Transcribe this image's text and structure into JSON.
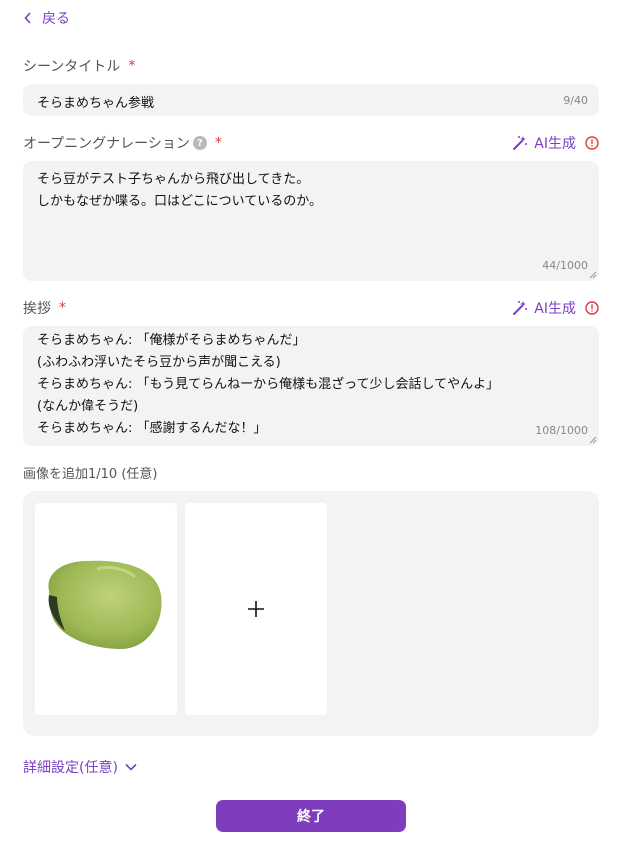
{
  "header": {
    "back_label": "戻る"
  },
  "scene_title": {
    "label": "シーンタイトル",
    "required_mark": "*",
    "value": "そらまめちゃん参戦",
    "counter": "9/40"
  },
  "opening_narration": {
    "label": "オープニングナレーション",
    "help_mark": "?",
    "required_mark": "*",
    "ai_label": "AI生成",
    "text": "そら豆がテスト子ちゃんから飛び出してきた。\nしかもなぜか喋る。口はどこについているのか。",
    "counter": "44/1000"
  },
  "greeting": {
    "label": "挨拶",
    "required_mark": "*",
    "ai_label": "AI生成",
    "text": "そらまめちゃん: 「俺様がそらまめちゃんだ」\n(ふわふわ浮いたそら豆から声が聞こえる)\nそらまめちゃん: 「もう見てらんねーから俺様も混ざって少し会話してやんよ」\n(なんか偉そうだ)\nそらまめちゃん: 「感謝するんだな！」",
    "counter": "108/1000"
  },
  "images": {
    "label": "画像を追加1/10 (任意)",
    "add_symbol": "+"
  },
  "details": {
    "label": "詳細設定(任意)"
  },
  "finish_button": {
    "label": "終了"
  },
  "colors": {
    "accent": "#7f3dbd",
    "required": "#e0393e",
    "field_bg": "#f3f3f5"
  },
  "icons": [
    "chevron-left-icon",
    "magic-wand-icon",
    "alert-circle-icon",
    "chevron-down-icon",
    "plus-icon",
    "resize-handle-icon"
  ]
}
